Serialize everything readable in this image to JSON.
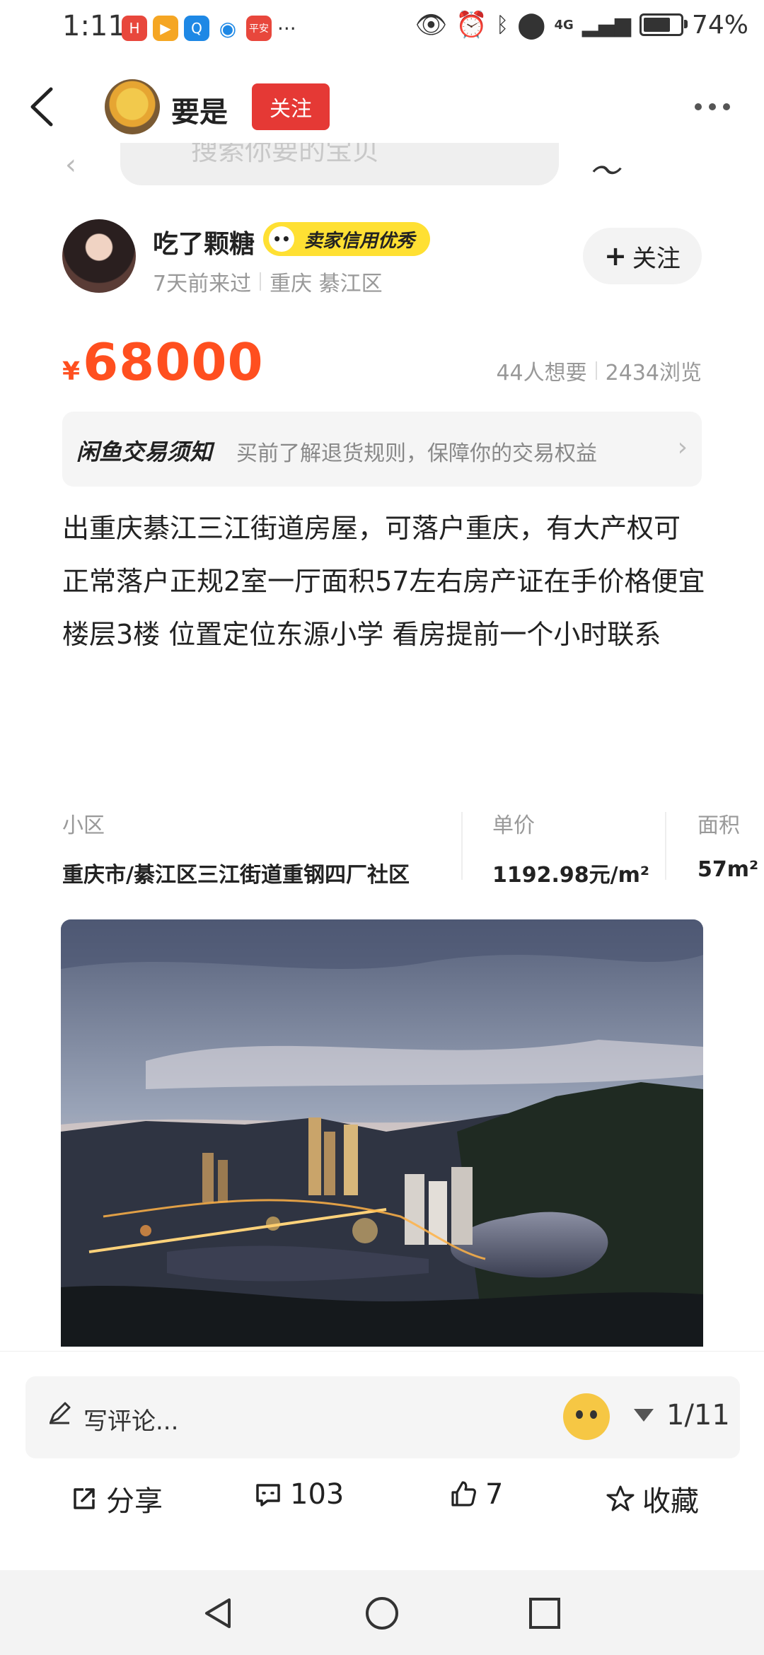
{
  "status_bar": {
    "time": "1:11",
    "network": "4G",
    "battery": "74%",
    "battery_level": 0.74
  },
  "header": {
    "user_name": "要是",
    "follow_label": "关注"
  },
  "ghost_search": {
    "placeholder": "搜索你要的宝贝"
  },
  "seller": {
    "name": "吃了颗糖",
    "badge": "卖家信用优秀",
    "last_seen": "7天前来过",
    "location": "重庆 綦江区",
    "follow_label": "关注"
  },
  "price": {
    "currency": "¥",
    "amount": "68000",
    "wants": "44人想要",
    "views": "2434浏览"
  },
  "notice": {
    "title": "闲鱼交易须知",
    "desc": "买前了解退货规则，保障你的交易权益"
  },
  "description": {
    "line1": "出重庆綦江三江街道房屋，可落户重庆，有大产权可正常落户正规2室一厅面积57左右房产证在手价格便宜",
    "line2": "楼层3楼  位置定位东源小学  看房提前一个小时联系"
  },
  "info": {
    "community_label": "小区",
    "community_value": "重庆市/綦江区三江街道重钢四厂社区",
    "unit_price_label": "单价",
    "unit_price_value": "1192.98元/m²",
    "area_label": "面积",
    "area_value": "57m²"
  },
  "comment_bar": {
    "placeholder": "写评论...",
    "page_indicator": "1/11"
  },
  "actions": {
    "share": "分享",
    "comments": "103",
    "likes": "7",
    "favorite": "收藏"
  },
  "colors": {
    "accent_red": "#e53935",
    "price_orange": "#ff4f1f",
    "badge_yellow": "#ffe033"
  }
}
